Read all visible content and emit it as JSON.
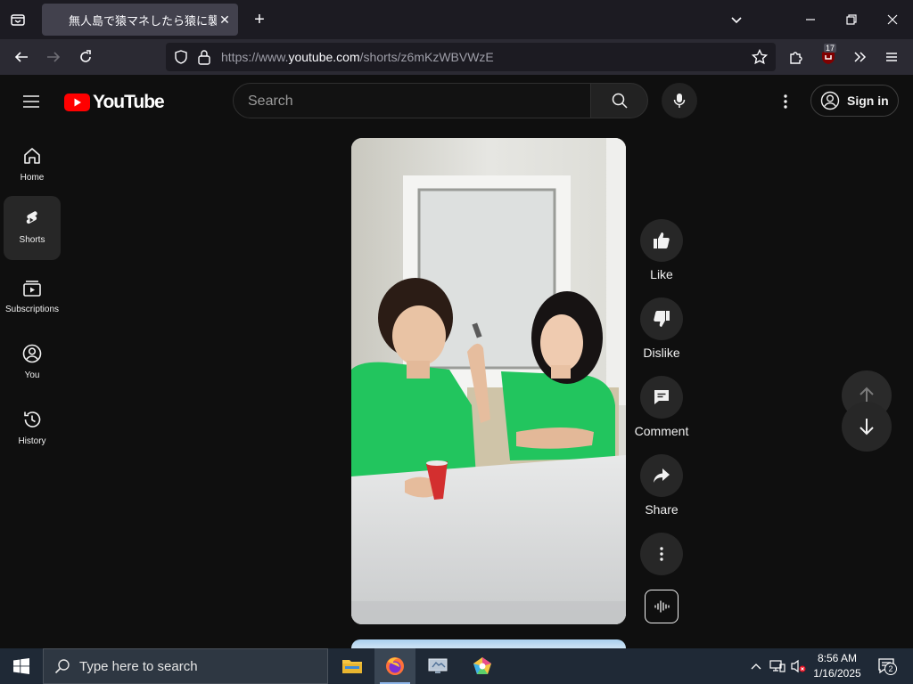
{
  "browser": {
    "tab_title": "無人島で猿マネしたら猿に襲わ",
    "tab_close": "✕",
    "new_tab": "+",
    "url_prefix": "https://www.",
    "url_domain": "youtube.com",
    "url_path": "/shorts/z6mKzWBVWzE",
    "extension_badge": "17"
  },
  "header": {
    "logo_text": "YouTube",
    "search_placeholder": "Search",
    "signin_label": "Sign in"
  },
  "sidebar": {
    "items": [
      {
        "label": "Home",
        "icon": "home-icon"
      },
      {
        "label": "Shorts",
        "icon": "shorts-icon"
      },
      {
        "label": "Subscriptions",
        "icon": "subscriptions-icon"
      },
      {
        "label": "You",
        "icon": "you-icon"
      },
      {
        "label": "History",
        "icon": "history-icon"
      }
    ]
  },
  "actions": {
    "like": "Like",
    "dislike": "Dislike",
    "comment": "Comment",
    "share": "Share"
  },
  "taskbar": {
    "search_text": "Type here to search",
    "time": "8:56 AM",
    "date": "1/16/2025",
    "notification_count": "2"
  },
  "colors": {
    "background": "#0f0f0f",
    "youtube_red": "#ff0000",
    "shirt_green": "#22c55e",
    "cup_red": "#d32f2f"
  }
}
